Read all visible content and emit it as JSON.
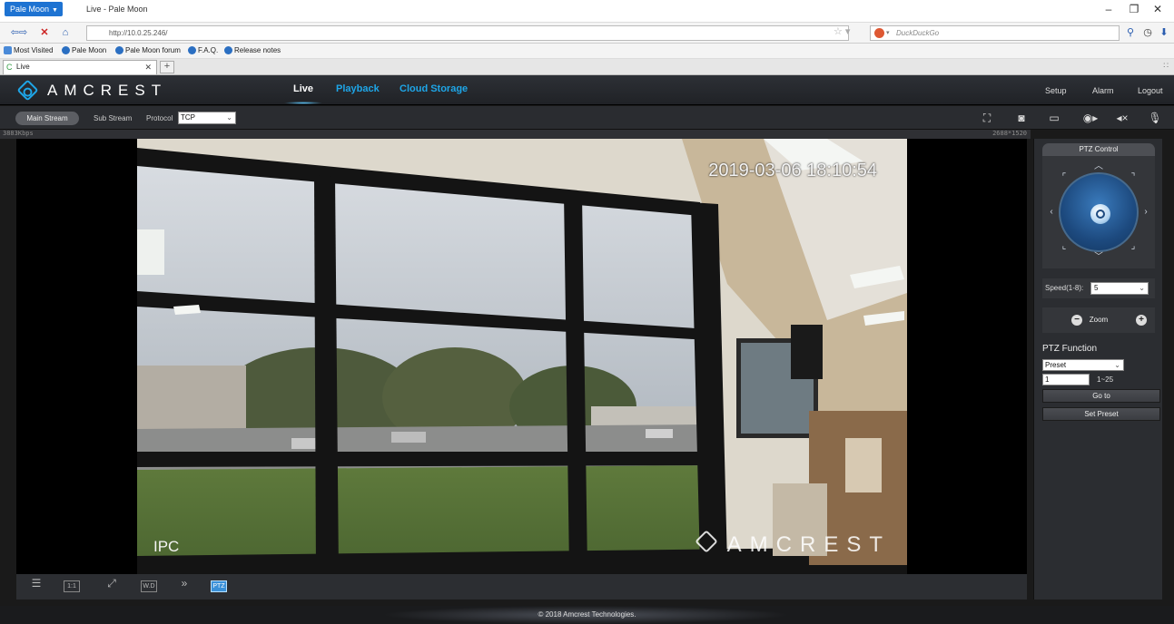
{
  "browser": {
    "app_menu_label": "Pale Moon",
    "window_title": "Live - Pale Moon",
    "url": "http://10.0.25.246/",
    "search_placeholder": "DuckDuckGo",
    "bookmarks": [
      "Most Visited",
      "Pale Moon",
      "Pale Moon forum",
      "F.A.Q.",
      "Release notes"
    ],
    "tab_title": "Live"
  },
  "header": {
    "logo_text": "AMCREST",
    "tabs": [
      "Live",
      "Playback",
      "Cloud Storage"
    ],
    "active_tab": "Live",
    "links": [
      "Setup",
      "Alarm",
      "Logout"
    ]
  },
  "stream_bar": {
    "main_stream": "Main Stream",
    "sub_stream": "Sub Stream",
    "protocol_label": "Protocol",
    "protocol_value": "TCP",
    "tool_icons": [
      "fullscreen-icon",
      "snapshot-icon",
      "image-icon",
      "record-icon",
      "audio-icon",
      "microphone-icon"
    ]
  },
  "video": {
    "bitrate": "3883Kbps",
    "resolution": "2688*1520",
    "osd_time": "2019-03-06 18:10:54",
    "osd_name": "IPC",
    "osd_brand": "AMCREST"
  },
  "bottom_toolbar": {
    "icons": [
      "adjust-icon",
      "original-size-icon",
      "fullscreen-icon",
      "wide-dynamic-icon",
      "fast-forward-icon",
      "ptz-icon"
    ],
    "ptz_label": "PTZ",
    "size_label": "1:1",
    "wd_label": "W.D"
  },
  "ptz": {
    "title": "PTZ Control",
    "speed_label": "Speed(1-8):",
    "speed_value": "5",
    "zoom_label": "Zoom",
    "function_title": "PTZ Function",
    "function_value": "Preset",
    "preset_value": "1",
    "preset_range": "1~25",
    "goto_label": "Go to",
    "set_preset_label": "Set Preset"
  },
  "footer": {
    "copyright": "© 2018 Amcrest Technologies."
  },
  "colors": {
    "accent": "#1ea6e8",
    "browser_accent": "#1e73d2",
    "panel": "#2b2d31"
  }
}
